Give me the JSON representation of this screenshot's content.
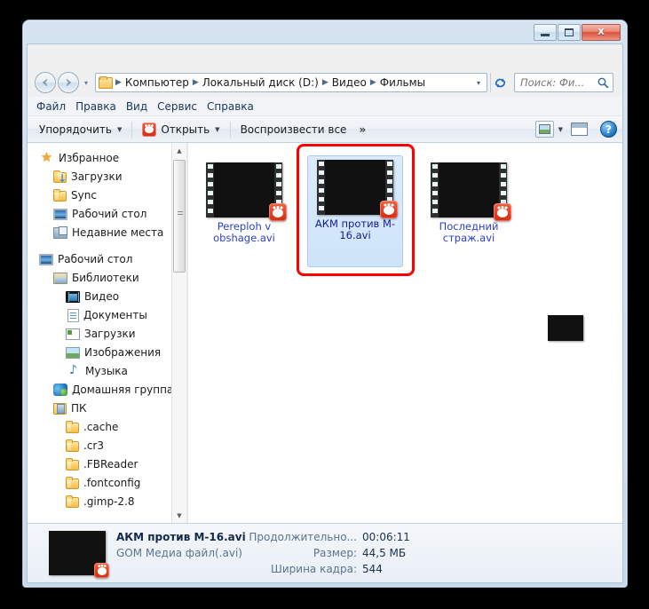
{
  "window": {
    "buttons": {
      "minimize": "–",
      "maximize": "□",
      "close": "X"
    }
  },
  "navigation": {
    "back_label": "Назад",
    "forward_label": "Вперёд",
    "history_dropdown": "▾",
    "breadcrumbs": [
      "Компьютер",
      "Локальный диск (D:)",
      "Видео",
      "Фильмы"
    ],
    "address_dropdown": "▾",
    "refresh_label": "Обновить"
  },
  "search": {
    "value": "",
    "placeholder": "Поиск: Фи...",
    "icon": "search-icon"
  },
  "menubar": [
    {
      "label": "Файл",
      "accel": "Ф"
    },
    {
      "label": "Правка",
      "accel": "П"
    },
    {
      "label": "Вид",
      "accel": "В"
    },
    {
      "label": "Сервис",
      "accel": "е"
    },
    {
      "label": "Справка",
      "accel": "С"
    }
  ],
  "toolbar": {
    "organize": "Упорядочить",
    "open": "Открыть",
    "play_all": "Воспроизвести все",
    "overflow": "»",
    "caret": "▼",
    "change_view": "change-view-icon",
    "preview_pane": "preview-pane-icon",
    "help": "?"
  },
  "sidebar": {
    "groups": [
      {
        "header": {
          "label": "Избранное",
          "icon": "star-icon"
        },
        "items": [
          {
            "label": "Загрузки",
            "icon": "downloads-folder-icon"
          },
          {
            "label": "Sync",
            "icon": "folder-icon"
          },
          {
            "label": "Рабочий стол",
            "icon": "desktop-icon"
          },
          {
            "label": "Недавние места",
            "icon": "recent-places-icon"
          }
        ]
      },
      {
        "header": {
          "label": "Рабочий стол",
          "icon": "desktop-icon"
        },
        "items": [
          {
            "label": "Библиотеки",
            "icon": "libraries-icon",
            "indent": 1
          },
          {
            "label": "Видео",
            "icon": "video-library-icon",
            "indent": 2
          },
          {
            "label": "Документы",
            "icon": "documents-library-icon",
            "indent": 2
          },
          {
            "label": "Загрузки",
            "icon": "downloads-library-icon",
            "indent": 2
          },
          {
            "label": "Изображения",
            "icon": "pictures-library-icon",
            "indent": 2
          },
          {
            "label": "Музыка",
            "icon": "music-library-icon",
            "indent": 2
          },
          {
            "label": "Домашняя группа",
            "icon": "homegroup-icon",
            "indent": 1
          },
          {
            "label": "ПК",
            "icon": "user-folder-icon",
            "indent": 1
          },
          {
            "label": ".cache",
            "icon": "folder-icon",
            "indent": 2
          },
          {
            "label": ".cr3",
            "icon": "folder-icon",
            "indent": 2
          },
          {
            "label": ".FBReader",
            "icon": "folder-icon",
            "indent": 2
          },
          {
            "label": ".fontconfig",
            "icon": "folder-icon",
            "indent": 2
          },
          {
            "label": ".gimp-2.8",
            "icon": "folder-icon",
            "indent": 2
          }
        ]
      }
    ],
    "scrollbar": {
      "up": "▲",
      "down": "▼"
    }
  },
  "files": [
    {
      "name": "Pereploh v obshage.avi",
      "thumb": "group-photo",
      "overlay_icon": "gom-player-icon",
      "selected": false
    },
    {
      "name": "АКМ против M-16.avi",
      "thumb": "man-with-rifle",
      "overlay_icon": "gom-player-icon",
      "selected": true
    },
    {
      "name": "Последний страж.avi",
      "thumb": "black-frame",
      "overlay_icon": "gom-player-icon",
      "selected": false
    }
  ],
  "drag_ghost": {
    "thumb": "man-with-rifle"
  },
  "details": {
    "filename": "АКМ против M-16.avi",
    "filetype": "GOM Медиа файл(.avi)",
    "fields": [
      {
        "label": "Продолжительно...",
        "value": "00:06:11"
      },
      {
        "label": "Размер:",
        "value": "44,5 МБ"
      },
      {
        "label": "Ширина кадра:",
        "value": "544"
      }
    ]
  },
  "colors": {
    "selection_ring": "#ff0000",
    "link_text": "#2b3fd0",
    "accent_red": "#d62a10",
    "window_chrome": "#cfe0f0"
  }
}
